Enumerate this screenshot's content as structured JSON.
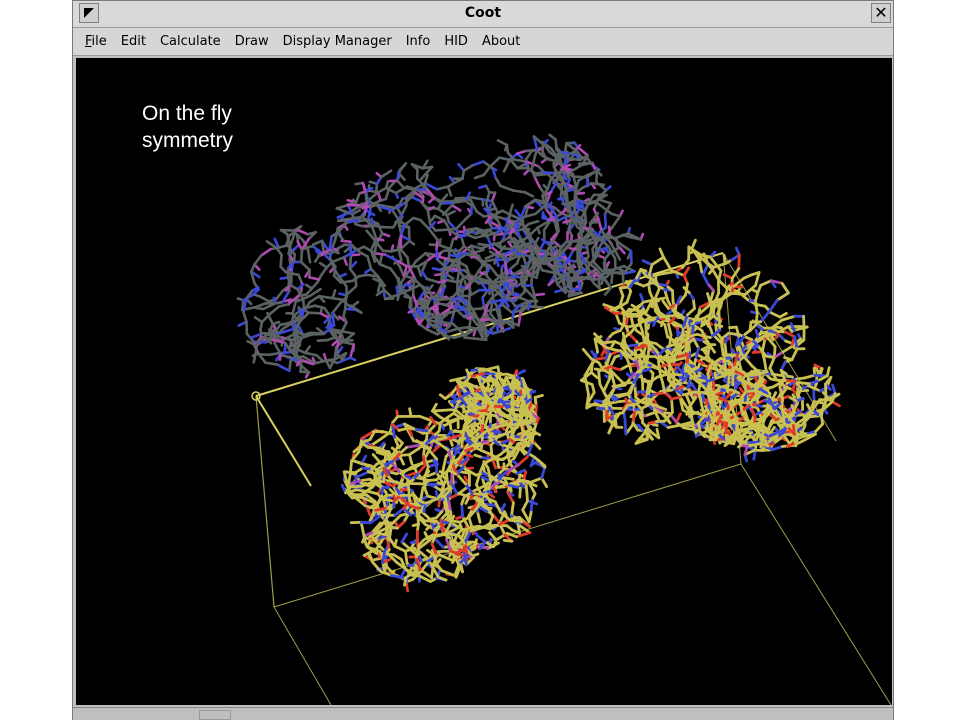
{
  "window": {
    "title": "Coot",
    "close_label": "✕"
  },
  "menu": {
    "items": [
      {
        "label": "File",
        "name": "menu-file"
      },
      {
        "label": "Edit",
        "name": "menu-edit"
      },
      {
        "label": "Calculate",
        "name": "menu-calculate"
      },
      {
        "label": "Draw",
        "name": "menu-draw"
      },
      {
        "label": "Display Manager",
        "name": "menu-display-manager"
      },
      {
        "label": "Info",
        "name": "menu-info"
      },
      {
        "label": "HID",
        "name": "menu-hid"
      },
      {
        "label": "About",
        "name": "menu-about"
      }
    ]
  },
  "viewer": {
    "annotation_line1": "On the fly",
    "annotation_line2": "symmetry",
    "background": "#000000",
    "colors": {
      "original_molecule": "#5a6262",
      "symmetry_molecule": "#c8c050",
      "unit_cell": "#d8d060",
      "nitrogen": "#3a48d8",
      "oxygen": "#e03a2a",
      "sulfur_marker": "#b04ab0"
    }
  }
}
